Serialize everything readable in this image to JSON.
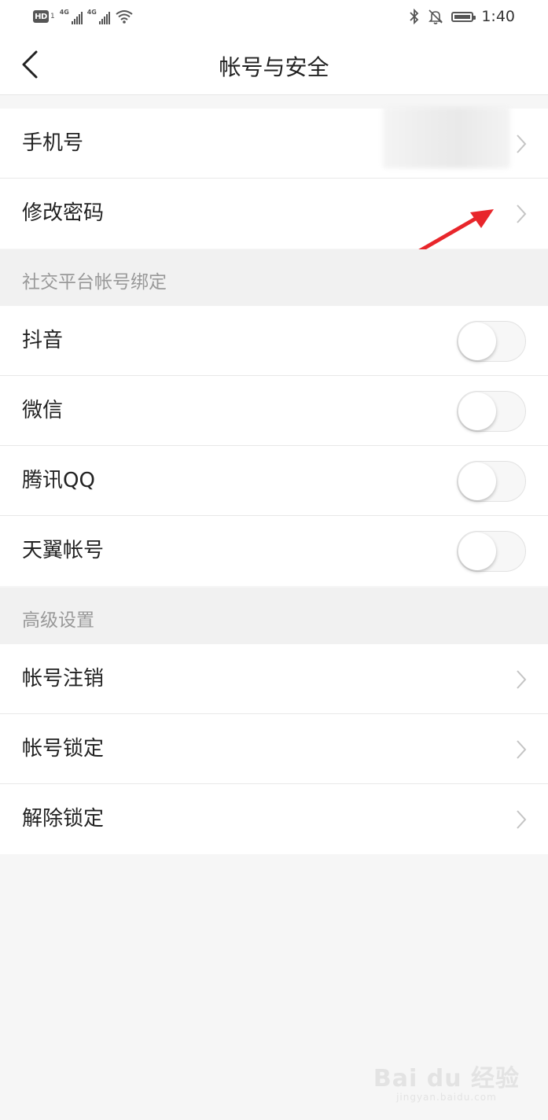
{
  "status_bar": {
    "hd_badge": "HD",
    "sim_number": "1",
    "network_1": "4G",
    "network_2": "4G",
    "time": "1:40",
    "icons": [
      "hd-icon",
      "signal-icon",
      "signal-icon",
      "wifi-icon",
      "bluetooth-icon",
      "mute-bell-icon",
      "battery-icon"
    ]
  },
  "nav": {
    "title": "帐号与安全",
    "back_icon": "chevron-left-icon"
  },
  "account_group": [
    {
      "label": "手机号",
      "value_blurred": true
    },
    {
      "label": "修改密码"
    }
  ],
  "social_section": {
    "header": "社交平台帐号绑定",
    "items": [
      {
        "label": "抖音",
        "enabled": false
      },
      {
        "label": "微信",
        "enabled": false
      },
      {
        "label": "腾讯QQ",
        "enabled": false
      },
      {
        "label": "天翼帐号",
        "enabled": false
      }
    ]
  },
  "advanced_section": {
    "header": "高级设置",
    "items": [
      {
        "label": "帐号注销"
      },
      {
        "label": "帐号锁定"
      },
      {
        "label": "解除锁定"
      }
    ]
  },
  "annotation": {
    "color": "#e8262b"
  },
  "watermark": {
    "main": "Bai du 经验",
    "sub": "jingyan.baidu.com"
  }
}
